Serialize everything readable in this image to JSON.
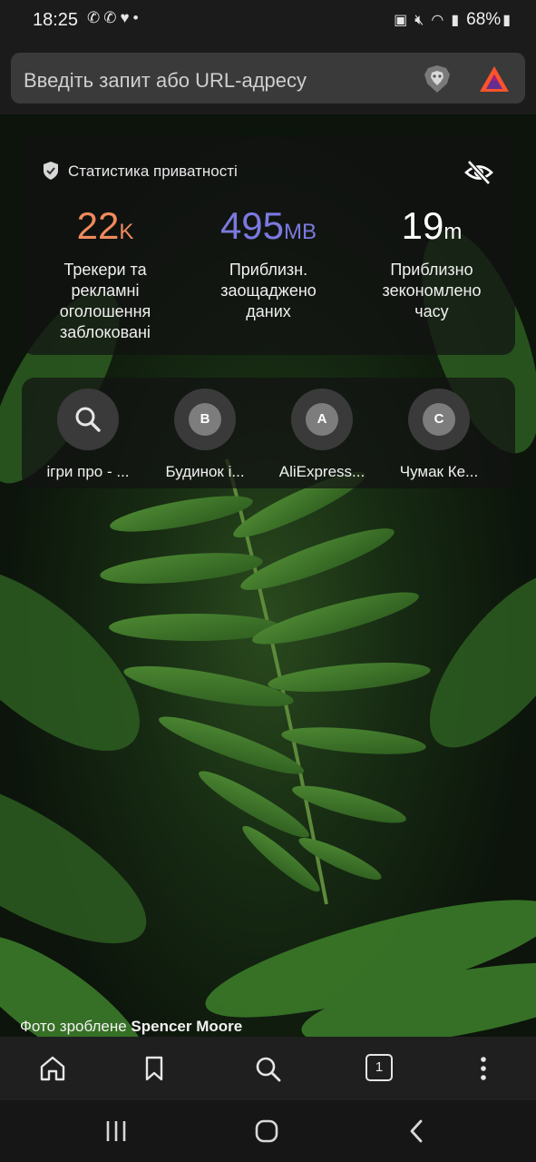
{
  "status_bar": {
    "time": "18:25",
    "battery": "68%",
    "icons": [
      "viber-icon",
      "viber-icon",
      "heart-app-icon",
      "dot-icon",
      "battery-saver-icon",
      "mute-icon",
      "wifi-icon",
      "signal-icon",
      "battery-icon"
    ]
  },
  "urlbar": {
    "placeholder": "Введіть запит або URL-адресу"
  },
  "privacy_stats": {
    "title": "Статистика приватності",
    "items": [
      {
        "value": "22",
        "unit": "K",
        "color": "#f08a5d",
        "label": "Трекери та рекламні оголошення заблоковані"
      },
      {
        "value": "495",
        "unit": "MB",
        "color": "#7b79e0",
        "label": "Приблизн. заощаджено даних"
      },
      {
        "value": "19",
        "unit": "m",
        "color": "#ffffff",
        "label": "Приблизно зекономлено часу"
      }
    ]
  },
  "top_sites": [
    {
      "icon": "search-icon",
      "letter": "",
      "label": "ігри про - ..."
    },
    {
      "icon": "letter-icon",
      "letter": "B",
      "label": "Будинок і..."
    },
    {
      "icon": "letter-icon",
      "letter": "A",
      "label": "AliExpress..."
    },
    {
      "icon": "letter-icon",
      "letter": "C",
      "label": "Чумак Ке..."
    }
  ],
  "photo_credit": {
    "prefix": "Фото зроблене",
    "author": "Spencer Moore"
  },
  "toolbar": {
    "tab_count": "1"
  },
  "colors": {
    "brave_orange": "#fb542b",
    "bat_purple": "#662d91"
  }
}
